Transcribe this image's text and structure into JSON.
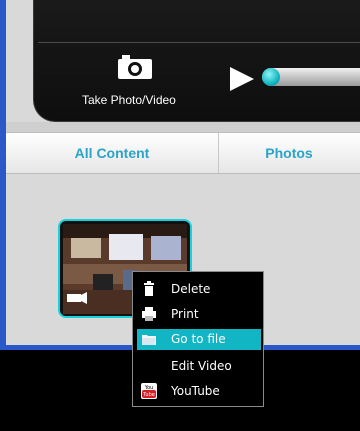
{
  "camera": {
    "take_label": "Take Photo/Video"
  },
  "tabs": [
    {
      "label": "All Content"
    },
    {
      "label": "Photos"
    }
  ],
  "context_menu": {
    "items": [
      {
        "label": "Delete",
        "icon": "trash-icon"
      },
      {
        "label": "Print",
        "icon": "printer-icon"
      },
      {
        "label": "Go to file",
        "icon": "folder-icon",
        "highlighted": true
      },
      {
        "label": "Edit Video",
        "icon": ""
      },
      {
        "label": "YouTube",
        "icon": "youtube-icon"
      }
    ]
  },
  "colors": {
    "accent": "#12b5c4",
    "frame_blue": "#2a58c8",
    "tab_text": "#2aa4c8"
  }
}
